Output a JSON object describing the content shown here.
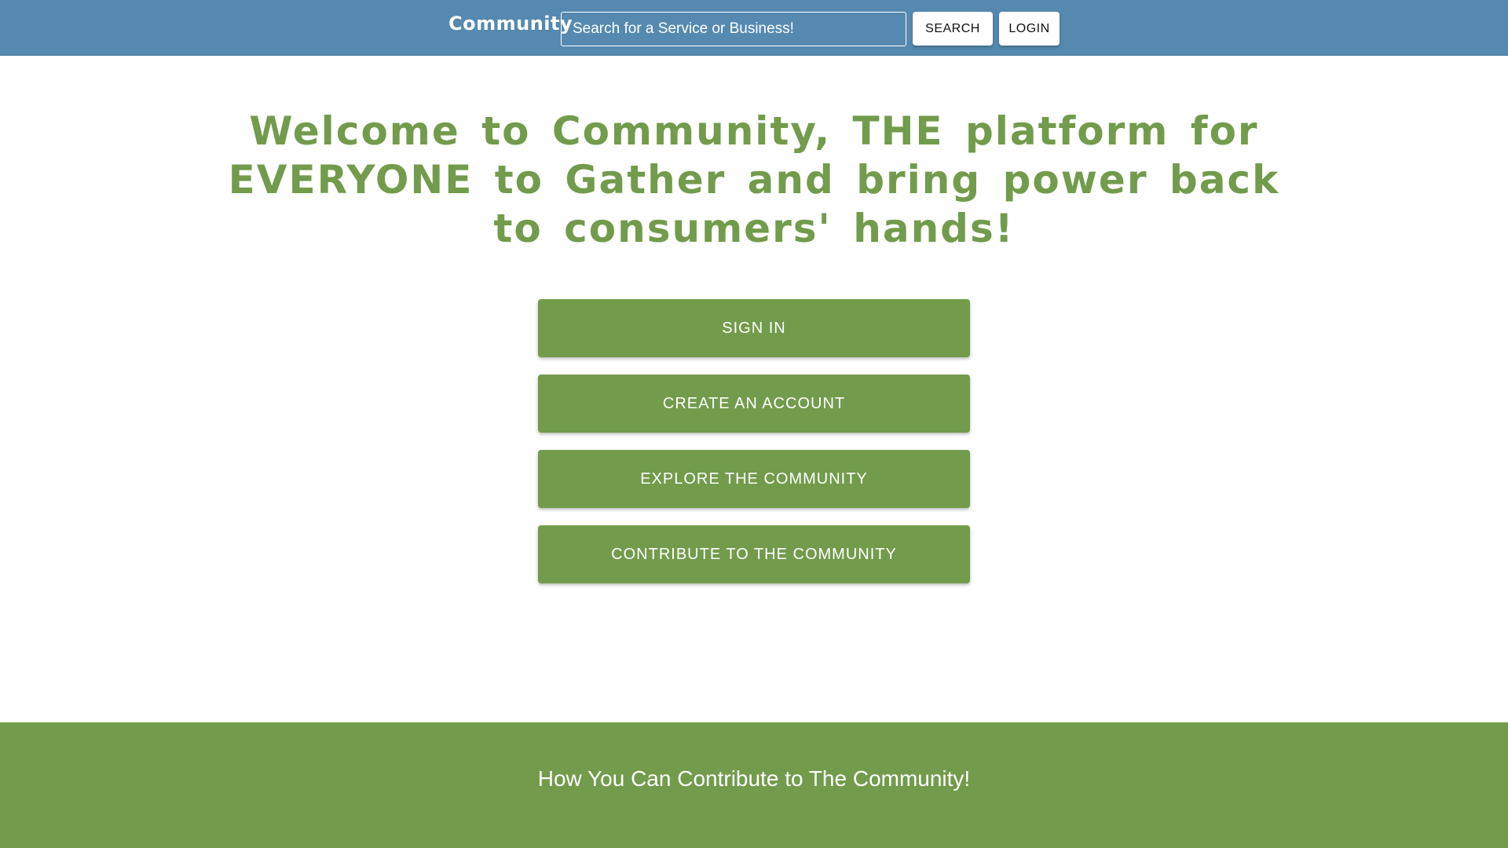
{
  "header": {
    "brand": "Community",
    "search": {
      "placeholder": "Search for a Service or Business!",
      "value": ""
    },
    "search_button": "SEARCH",
    "login_button": "LOGIN"
  },
  "hero": {
    "headline": "Welcome to Community, THE platform for EVERYONE to Gather and bring power back to consumers' hands!"
  },
  "actions": {
    "sign_in": "SIGN IN",
    "create_account": "CREATE AN ACCOUNT",
    "explore": "EXPLORE THE COMMUNITY",
    "contribute": "CONTRIBUTE TO THE COMMUNITY"
  },
  "footer": {
    "title": "How You Can Contribute to The Community!"
  },
  "colors": {
    "header_bg": "#5589b0",
    "accent_green": "#729b4c",
    "page_bg": "#ffffff"
  }
}
